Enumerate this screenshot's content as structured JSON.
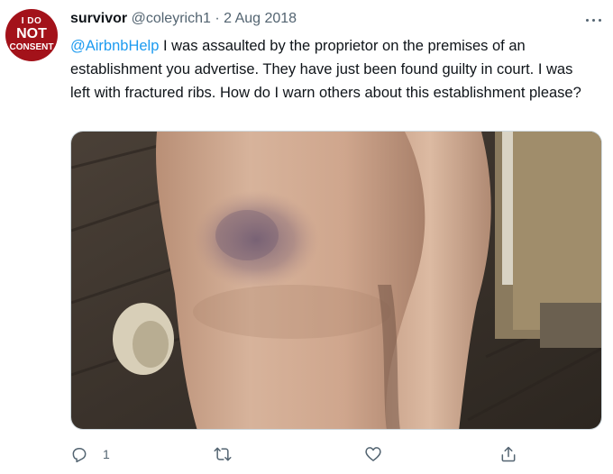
{
  "tweet": {
    "avatar": {
      "line1": "I DO",
      "line2": "NOT",
      "line3": "CONSENT"
    },
    "author": {
      "display_name": "survivor",
      "handle": "@coleyrich1"
    },
    "separator": "·",
    "date": "2 Aug 2018",
    "text": {
      "mention": "@AirbnbHelp",
      "body": " I was assaulted by the proprietor on the premises of an establishment you advertise. They have just been found guilty in court. I was left with fractured ribs. How do I warn others about this establishment please?"
    },
    "media": {
      "description_icon": "photo-of-bruised-leg"
    },
    "actions": {
      "reply_count": "1",
      "icons": [
        "reply-icon",
        "retweet-icon",
        "like-icon",
        "share-icon"
      ]
    }
  },
  "colors": {
    "text": "#0f1419",
    "secondary": "#536471",
    "link": "#1d9bf0",
    "avatar_bg": "#a3121a"
  }
}
